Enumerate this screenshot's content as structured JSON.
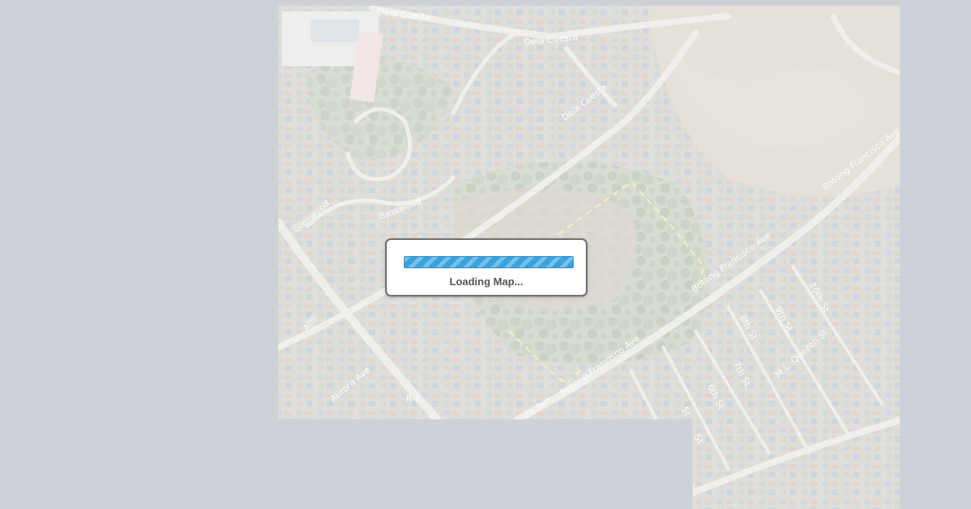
{
  "loading": {
    "message": "Loading Map...",
    "progress_fraction": 1.0
  },
  "map": {
    "style": "satellite",
    "labels": {
      "dela_cuesta_1": "Dela Cuesta",
      "dela_cuesta_2": "Dela Cuesta",
      "dela_cuesta_3": "Dela Cuesta",
      "glenwood": "Glenwood",
      "basswood": "Basswood",
      "atis": "Atis",
      "aurora_ave": "Aurora Ave",
      "botong_1": "Botong Francisco Ave",
      "botong_2": "Botong Francisco Ave",
      "botong_3": "Botong Francisco Ave",
      "botong_4": "co Ave",
      "r5": "R-5",
      "tenth_st": "10th St",
      "ninth_st": "9th St",
      "eighth_st": "8th St",
      "seventh_st": "7th St",
      "sixth_st": "6th St",
      "fifth_st": "5t",
      "fourth_st": "St",
      "ml_quezon": "M.L. Quezon St"
    }
  },
  "colors": {
    "background": "#ced2d8",
    "progress_blue": "#3aa3dd",
    "dialog_border": "#6f6f6f",
    "road_yellow": "#e8e07a"
  }
}
